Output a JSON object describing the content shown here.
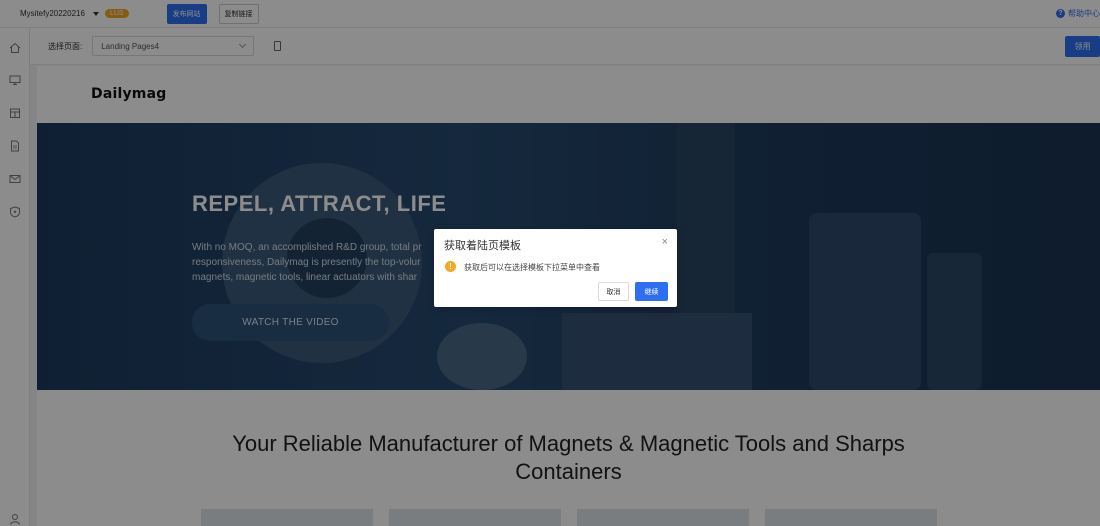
{
  "topbar": {
    "site_name": "Mysitefy20220216",
    "badge": "LUS",
    "publish_label": "发布网站",
    "copy_link_label": "复制链接",
    "help_label": "帮助中心"
  },
  "toolbar": {
    "select_page_label": "选择页面:",
    "page_value": "Landing Pages4",
    "apply_label": "领用"
  },
  "rail": {
    "icons": [
      "home-icon",
      "monitor-icon",
      "store-icon",
      "document-icon",
      "mail-icon",
      "shield-icon",
      "user-icon"
    ]
  },
  "preview": {
    "logo": "Dailymag",
    "hero_title": "REPEL, ATTRACT, LIFE",
    "hero_text": "With no MOQ, an accomplished R&D group, total pr responsiveness, Dailymag is presently the top-volur magnets, magnetic tools, linear actuators with shar",
    "hero_cta": "WATCH THE VIDEO",
    "section_title": "Your Reliable Manufacturer of Magnets & Magnetic Tools and Sharps Containers"
  },
  "dialog": {
    "title": "获取着陆页模板",
    "message": "获取后可以在选择模板下拉菜单中查看",
    "cancel_label": "取消",
    "ok_label": "继续",
    "close_glyph": "×",
    "warn_glyph": "!"
  },
  "colors": {
    "accent": "#2d6ff0",
    "warning": "#f5a623",
    "hero_bg": "#1e3b5c"
  }
}
